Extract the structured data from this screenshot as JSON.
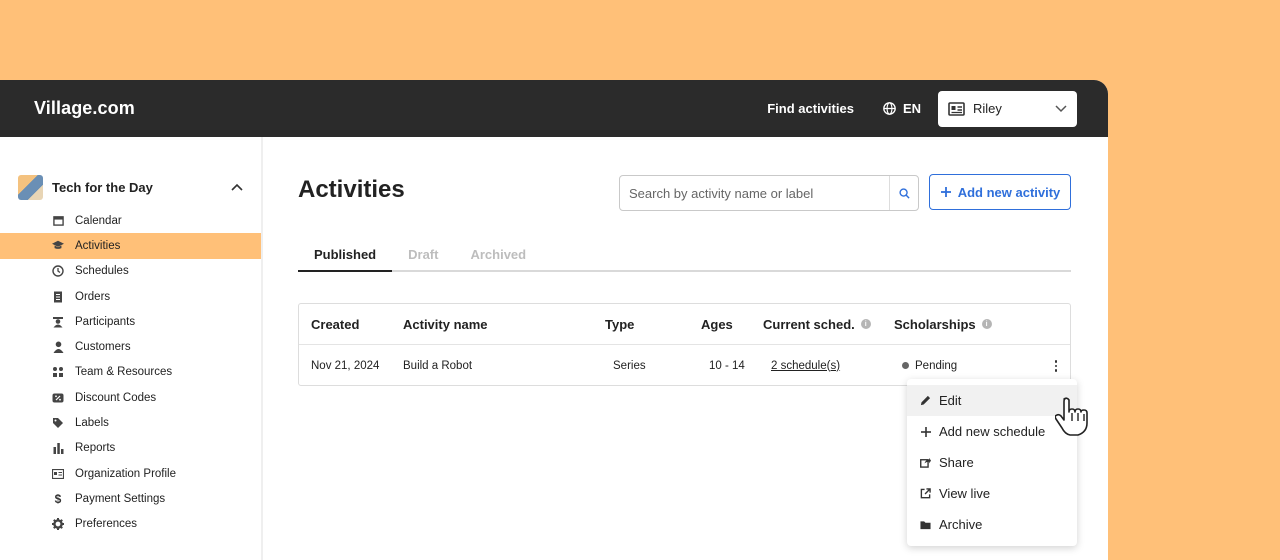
{
  "app": {
    "logo": "Village.com",
    "find_activities": "Find activities",
    "language": "EN",
    "user": "Riley"
  },
  "sidebar": {
    "org_name": "Tech for the Day",
    "items": [
      {
        "label": "Calendar",
        "icon": "calendar-icon"
      },
      {
        "label": "Activities",
        "icon": "graduation-cap-icon",
        "active": true
      },
      {
        "label": "Schedules",
        "icon": "clock-icon"
      },
      {
        "label": "Orders",
        "icon": "receipt-icon"
      },
      {
        "label": "Participants",
        "icon": "participant-icon"
      },
      {
        "label": "Customers",
        "icon": "person-icon"
      },
      {
        "label": "Team & Resources",
        "icon": "team-icon"
      },
      {
        "label": "Discount Codes",
        "icon": "discount-icon"
      },
      {
        "label": "Labels",
        "icon": "tag-icon"
      },
      {
        "label": "Reports",
        "icon": "bar-chart-icon"
      },
      {
        "label": "Organization Profile",
        "icon": "id-card-icon"
      },
      {
        "label": "Payment Settings",
        "icon": "dollar-icon"
      },
      {
        "label": "Preferences",
        "icon": "gear-icon"
      }
    ]
  },
  "main": {
    "title": "Activities",
    "search_placeholder": "Search by activity name or label",
    "add_button": "Add new activity",
    "tabs": [
      "Published",
      "Draft",
      "Archived"
    ],
    "table": {
      "headers": {
        "created": "Created",
        "activity_name": "Activity name",
        "type": "Type",
        "ages": "Ages",
        "current_sched": "Current sched.",
        "scholarships": "Scholarships"
      },
      "row": {
        "created": "Nov 21, 2024",
        "activity_name": "Build a Robot",
        "type": "Series",
        "ages": "10 - 14",
        "current_sched": "2 schedule(s)",
        "scholarships": "Pending"
      }
    }
  },
  "menu": {
    "items": [
      {
        "label": "Edit",
        "icon": "pencil-icon"
      },
      {
        "label": "Add new schedule",
        "icon": "plus-icon"
      },
      {
        "label": "Share",
        "icon": "share-icon"
      },
      {
        "label": "View live",
        "icon": "external-link-icon"
      },
      {
        "label": "Archive",
        "icon": "folder-icon"
      }
    ]
  },
  "colors": {
    "background": "#FFC078",
    "topbar": "#2B2B2B",
    "active_nav": "#FFC078",
    "primary": "#2F6FDB"
  }
}
